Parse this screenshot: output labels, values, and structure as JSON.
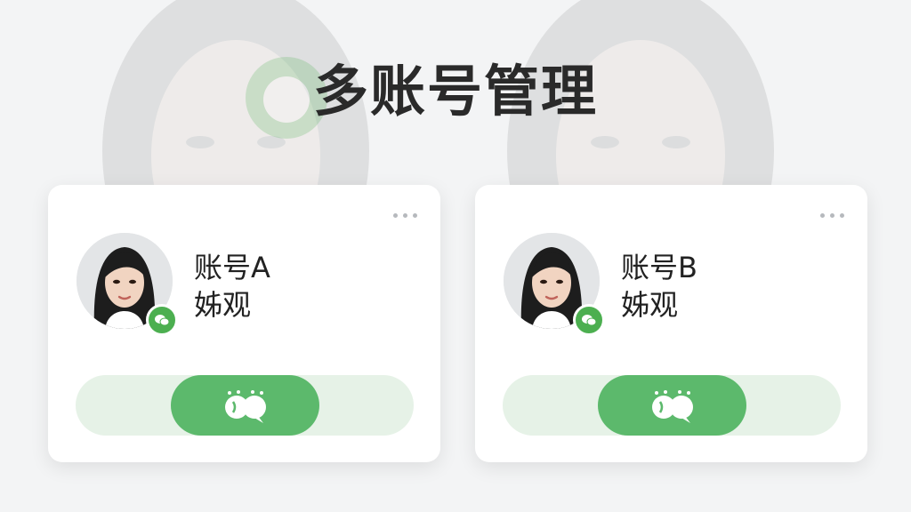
{
  "page": {
    "title": "多账号管理"
  },
  "accounts": [
    {
      "name": "账号A",
      "nickname": "姊观",
      "avatar_icon": "user-avatar-icon",
      "badge_icon": "wechat-badge-icon",
      "action_icon": "switch-chat-icon"
    },
    {
      "name": "账号B",
      "nickname": "姊观",
      "avatar_icon": "user-avatar-icon",
      "badge_icon": "wechat-badge-icon",
      "action_icon": "switch-chat-icon"
    }
  ],
  "colors": {
    "accent": "#5cb96c",
    "badge": "#4caf50",
    "track": "#e6f2e7",
    "background": "#f3f4f5",
    "card": "#ffffff",
    "title": "#2a2a2a"
  }
}
